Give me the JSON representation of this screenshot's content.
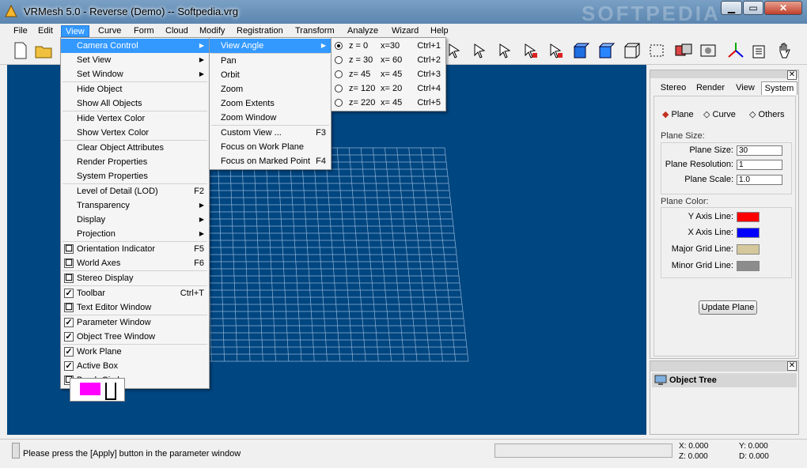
{
  "window": {
    "title": "VRMesh 5.0 - Reverse (Demo) -- Softpedia.vrg",
    "watermark": "SOFTPEDIA"
  },
  "menubar": [
    "File",
    "Edit",
    "View",
    "Curve",
    "Form",
    "Cloud",
    "Modify",
    "Registration",
    "Transform",
    "Analyze",
    "Wizard",
    "Help"
  ],
  "view_menu": {
    "items": [
      {
        "label": "Camera Control",
        "arrow": "▶"
      },
      {
        "label": "Set View",
        "arrow": "▶"
      },
      {
        "label": "Set Window",
        "arrow": "▶"
      },
      {
        "label": "Hide Object"
      },
      {
        "label": "Show All Objects"
      },
      {
        "label": "Hide Vertex Color"
      },
      {
        "label": "Show Vertex Color"
      },
      {
        "label": "Clear Object Attributes"
      },
      {
        "label": "Render Properties"
      },
      {
        "label": "System Properties"
      },
      {
        "label": "Level of Detail (LOD)",
        "shortcut": "F2"
      },
      {
        "label": "Transparency",
        "arrow": "▶"
      },
      {
        "label": "Display",
        "arrow": "▶"
      },
      {
        "label": "Projection",
        "arrow": "▶"
      },
      {
        "label": "Orientation Indicator",
        "shortcut": "F5",
        "check": "☐"
      },
      {
        "label": "World Axes",
        "shortcut": "F6",
        "check": "☐"
      },
      {
        "label": "Stereo Display",
        "check": "☐"
      },
      {
        "label": "Toolbar",
        "shortcut": "Ctrl+T",
        "check": "✓"
      },
      {
        "label": "Text Editor Window",
        "check": "☐"
      },
      {
        "label": "Parameter Window",
        "check": "✓"
      },
      {
        "label": "Object Tree Window",
        "check": "✓"
      },
      {
        "label": "Work Plane",
        "check": "✓"
      },
      {
        "label": "Active Box",
        "check": "✓"
      },
      {
        "label": "Brush Circle",
        "check": "☐"
      }
    ]
  },
  "camera_menu": {
    "items": [
      {
        "label": "View Angle",
        "arrow": "▶"
      },
      {
        "label": "Pan"
      },
      {
        "label": "Orbit"
      },
      {
        "label": "Zoom"
      },
      {
        "label": "Zoom Extents"
      },
      {
        "label": "Zoom Window"
      },
      {
        "label": "Custom View ...",
        "shortcut": "F3"
      },
      {
        "label": "Focus on Work Plane"
      },
      {
        "label": "Focus on Marked Point",
        "shortcut": "F4"
      }
    ]
  },
  "angle_menu": {
    "items": [
      {
        "z": "z = 0",
        "x": "x=30",
        "shortcut": "Ctrl+1",
        "selected": true
      },
      {
        "z": "z = 30",
        "x": "x= 60",
        "shortcut": "Ctrl+2"
      },
      {
        "z": "z= 45",
        "x": "x= 45",
        "shortcut": "Ctrl+3"
      },
      {
        "z": "z= 120",
        "x": "x= 20",
        "shortcut": "Ctrl+4"
      },
      {
        "z": "z= 220",
        "x": "x= 45",
        "shortcut": "Ctrl+5"
      }
    ]
  },
  "panel": {
    "tabs": [
      "Stereo",
      "Render",
      "View",
      "System"
    ],
    "radios": [
      "Plane",
      "Curve",
      "Others"
    ],
    "plane_size_label": "Plane Size:",
    "fields": [
      {
        "label": "Plane Size:",
        "value": "30"
      },
      {
        "label": "Plane Resolution:",
        "value": "1"
      },
      {
        "label": "Plane Scale:",
        "value": "1.0"
      }
    ],
    "plane_color_label": "Plane Color:",
    "colors": [
      {
        "label": "Y Axis Line:",
        "color": "#ff0000"
      },
      {
        "label": "X Axis Line:",
        "color": "#0000ff"
      },
      {
        "label": "Major Grid Line:",
        "color": "#d4c89c"
      },
      {
        "label": "Minor Grid Line:",
        "color": "#8c8c8c"
      }
    ],
    "update_button": "Update Plane"
  },
  "tree": {
    "title": "Object Tree"
  },
  "status": {
    "message": "Please press the [Apply] button in the parameter window",
    "x": "X: 0.000",
    "y": "Y: 0.000",
    "z": "Z: 0.000",
    "d": "D: 0.000"
  },
  "colors": {
    "viewport": "#004680",
    "grid": "#8fb3d6",
    "menu_highlight": "#3399ff"
  }
}
